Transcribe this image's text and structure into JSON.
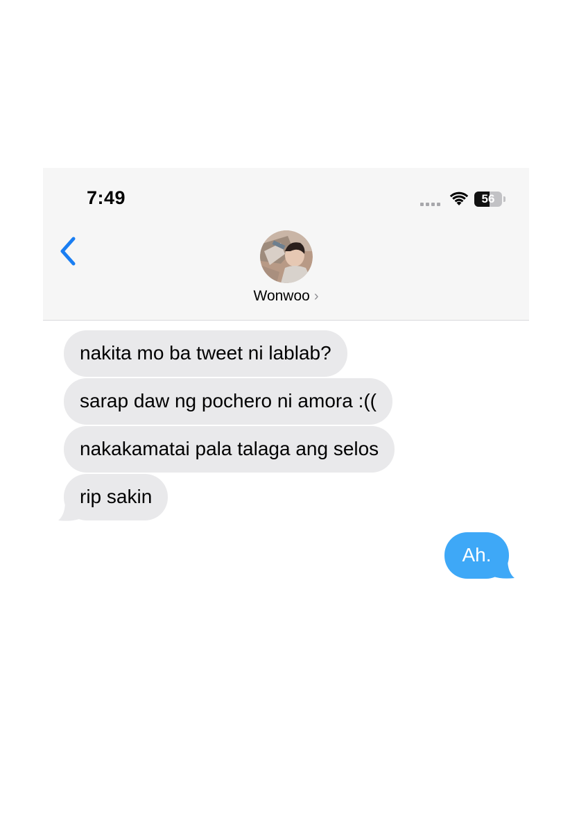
{
  "status_bar": {
    "time": "7:49",
    "battery_level": "56",
    "battery_fraction": 0.56,
    "icons": [
      "signal-dots-icon",
      "wifi-icon",
      "battery-icon"
    ]
  },
  "nav": {
    "back_icon": "chevron-left-icon",
    "contact_name": "Wonwoo",
    "contact_chevron": "›"
  },
  "colors": {
    "accent": "#1a7ef2",
    "incoming_bubble": "#e9e9eb",
    "outgoing_bubble": "#3ea8f7",
    "header_background": "#f6f6f6"
  },
  "messages": [
    {
      "direction": "incoming",
      "text": "nakita mo ba tweet ni lablab?"
    },
    {
      "direction": "incoming",
      "text": "sarap daw ng pochero ni amora :(("
    },
    {
      "direction": "incoming",
      "text": "nakakamatai pala talaga ang selos"
    },
    {
      "direction": "incoming",
      "text": "rip sakin"
    },
    {
      "direction": "outgoing",
      "text": "Ah."
    }
  ]
}
